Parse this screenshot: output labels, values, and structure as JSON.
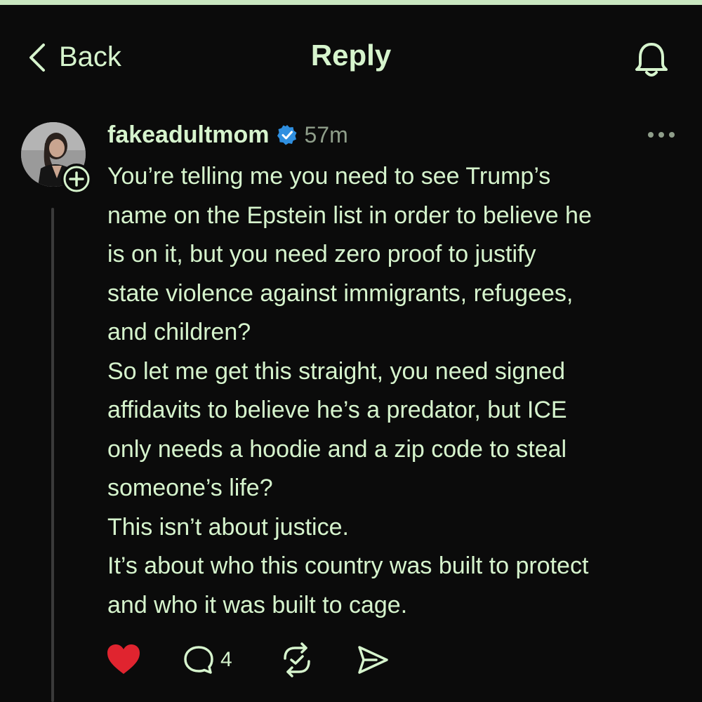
{
  "header": {
    "back_label": "Back",
    "title": "Reply"
  },
  "icons": {
    "back": "chevron-left-icon",
    "notifications": "bell-icon",
    "follow": "plus-icon",
    "verified": "verified-badge-icon",
    "more": "more-horizontal-icon",
    "like": "heart-icon",
    "reply": "comment-icon",
    "repost": "repost-icon",
    "share": "send-icon"
  },
  "colors": {
    "background": "#0b0b0b",
    "text": "#d6f4cd",
    "like": "#e0242f",
    "verified": "#2f8fe0"
  },
  "post": {
    "username": "fakeadultmom",
    "timestamp": "57m",
    "paragraphs": [
      "You’re telling me you need to see Trump’s\nname on the Epstein list in order to believe he\nis on it, but you need zero proof to justify\nstate violence against immigrants, refugees,\nand children?",
      "So let me get this straight, you need signed\naffidavits to believe he’s a predator, but ICE\nonly needs a hoodie and a zip code to steal\nsomeone’s life?",
      "This isn’t about justice.",
      "It’s about who this country was built to protect\nand who it was built to cage."
    ],
    "liked": true,
    "reply_count": "4"
  }
}
